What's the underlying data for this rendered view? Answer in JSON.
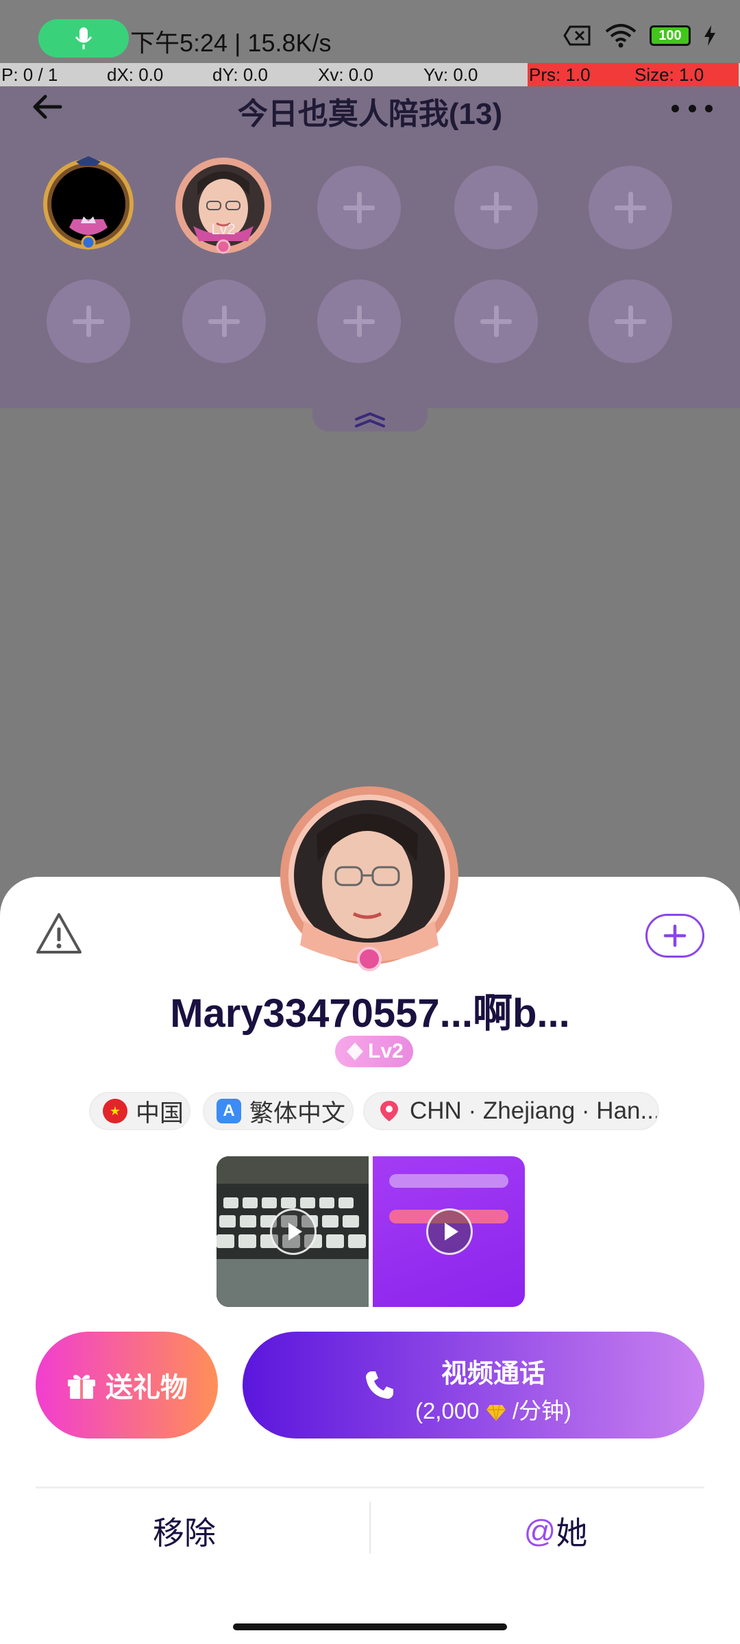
{
  "status_bar": {
    "time_speed": "下午5:24 | 15.8K/s",
    "battery": "100",
    "icons": [
      "microphone-icon",
      "sim-off-icon",
      "wifi-icon",
      "battery-icon",
      "charging-icon"
    ]
  },
  "debug": {
    "p": "P: 0 / 1",
    "dx": "dX: 0.0",
    "dy": "dY: 0.0",
    "xv": "Xv: 0.0",
    "yv": "Yv: 0.0",
    "prs": "Prs: 1.0",
    "size": "Size: 1.0"
  },
  "room": {
    "title": "今日也莫人陪我(13)",
    "seat_badge": "Lv2"
  },
  "profile": {
    "name": "Mary33470557...啊b...",
    "level": "Lv2",
    "country": "中国",
    "language": "繁体中文",
    "location": "CHN · Zhejiang · Han...",
    "lang_glyph": "A"
  },
  "actions": {
    "gift": "送礼物",
    "call_title": "视频通话",
    "call_price_prefix": "(2,000",
    "call_price_suffix": "/分钟)",
    "remove": "移除",
    "mention_at": "@",
    "mention_target": "她"
  },
  "colors": {
    "accent_purple": "#8b45e8",
    "gift_gradient": [
      "#f13ed0",
      "#ff8f57"
    ],
    "call_gradient": [
      "#5b16dd",
      "#c980f0"
    ]
  }
}
